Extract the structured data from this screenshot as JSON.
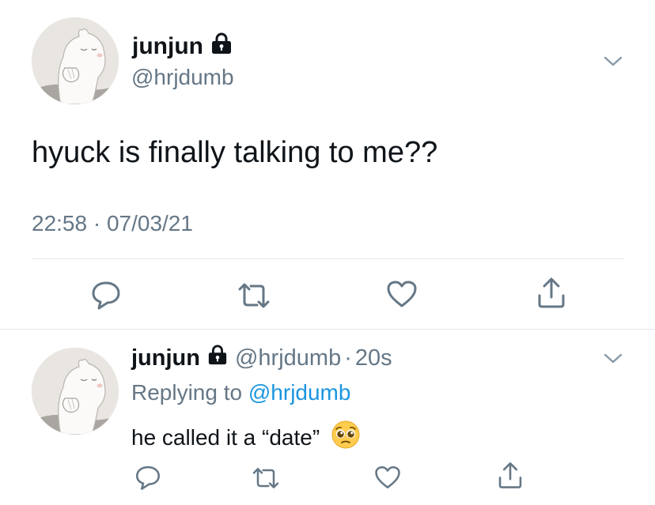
{
  "main_tweet": {
    "author": {
      "name": "junjun",
      "handle": "@hrjdumb",
      "avatar_icon": "moomin-avatar",
      "protected_icon": "lock-icon"
    },
    "text": "hyuck is finally talking to me??",
    "timestamp": "22:58 · 07/03/21",
    "actions": [
      "reply-icon",
      "retweet-icon",
      "like-icon",
      "share-icon"
    ]
  },
  "reply_tweet": {
    "author": {
      "name": "junjun",
      "handle": "@hrjdumb",
      "avatar_icon": "moomin-avatar",
      "protected_icon": "lock-icon"
    },
    "separator": "·",
    "time_ago": "20s",
    "replying_prefix": "Replying to",
    "replying_to": "@hrjdumb",
    "text": "he called it a “date”",
    "emoji_icon": "pleading-face-emoji",
    "actions": [
      "reply-icon",
      "retweet-icon",
      "like-icon",
      "share-icon"
    ]
  },
  "colors": {
    "text": "#0f1419",
    "secondary": "#657786",
    "link": "#1b95e0",
    "divider": "#e1e8ed"
  }
}
